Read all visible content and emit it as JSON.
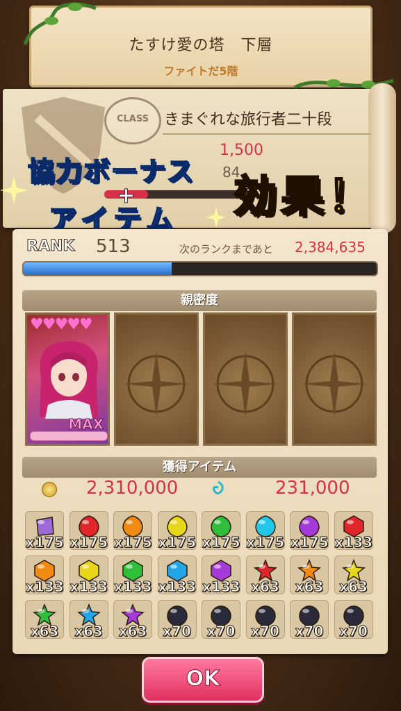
{
  "header": {
    "title": "たすけ愛の塔　下層",
    "subtitle": "ファイトだ5階"
  },
  "class_panel": {
    "stamp": "CLASS",
    "class_name": "きまぐれな旅行者二十段",
    "bp_value": "1,500",
    "bp2_value": "84"
  },
  "overlay": {
    "line1": "協力ボーナス",
    "plus": "+",
    "line2": "アイテム",
    "emphasis": "効果！"
  },
  "rank": {
    "label": "RANK",
    "value": "513",
    "next_label": "次のランクまであと",
    "next_value": "2,384,635",
    "progress": 0.42
  },
  "intimacy": {
    "header": "親密度",
    "hearts": "♥♥♥♥♥",
    "max_label": "MAX"
  },
  "items": {
    "header": "獲得アイテム",
    "coin_amount": "2,310,000",
    "second_amount": "231,000",
    "list": [
      {
        "icon": "pouch",
        "color": "#9c6bd8",
        "qty": "x175"
      },
      {
        "icon": "gem-round",
        "color": "#e0262b",
        "qty": "x175"
      },
      {
        "icon": "gem-round",
        "color": "#f08a12",
        "qty": "x175"
      },
      {
        "icon": "gem-round",
        "color": "#e8d61a",
        "qty": "x175"
      },
      {
        "icon": "gem-round",
        "color": "#2fbf3a",
        "qty": "x175"
      },
      {
        "icon": "gem-round",
        "color": "#22c6e8",
        "qty": "x175"
      },
      {
        "icon": "gem-round",
        "color": "#a43ad8",
        "qty": "x175"
      },
      {
        "icon": "gem-hex",
        "color": "#e0262b",
        "qty": "x133"
      },
      {
        "icon": "gem-hex",
        "color": "#f08a12",
        "qty": "x133"
      },
      {
        "icon": "gem-hex",
        "color": "#e8d61a",
        "qty": "x133"
      },
      {
        "icon": "gem-hex",
        "color": "#2fbf3a",
        "qty": "x133"
      },
      {
        "icon": "gem-hex",
        "color": "#22a6e8",
        "qty": "x133"
      },
      {
        "icon": "gem-hex",
        "color": "#a43ad8",
        "qty": "x133"
      },
      {
        "icon": "gem-star",
        "color": "#e0262b",
        "qty": "x63"
      },
      {
        "icon": "gem-star",
        "color": "#f08a12",
        "qty": "x63"
      },
      {
        "icon": "gem-star",
        "color": "#e8d61a",
        "qty": "x63"
      },
      {
        "icon": "gem-star",
        "color": "#2fbf3a",
        "qty": "x63"
      },
      {
        "icon": "gem-star",
        "color": "#22a6e8",
        "qty": "x63"
      },
      {
        "icon": "gem-star",
        "color": "#a43ad8",
        "qty": "x63"
      },
      {
        "icon": "orb",
        "color": "#2a2a3a",
        "qty": "x70"
      },
      {
        "icon": "orb",
        "color": "#2a2a3a",
        "qty": "x70"
      },
      {
        "icon": "orb",
        "color": "#2a2a3a",
        "qty": "x70"
      },
      {
        "icon": "orb",
        "color": "#2a2a3a",
        "qty": "x70"
      },
      {
        "icon": "orb",
        "color": "#2a2a3a",
        "qty": "x70"
      }
    ]
  },
  "ok_label": "OK"
}
